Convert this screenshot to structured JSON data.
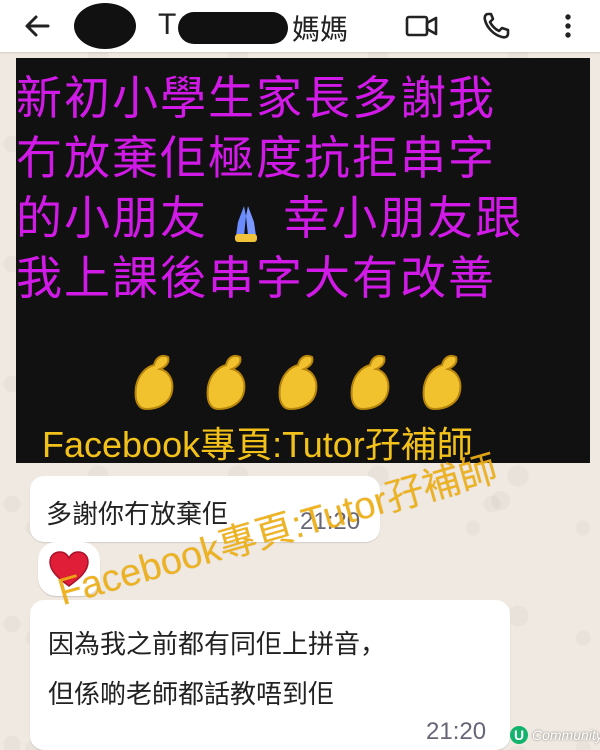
{
  "header": {
    "title_visible_start": "T",
    "title_visible_end": "媽媽",
    "back_icon": "back-arrow-icon",
    "video_icon": "video-camera-icon",
    "call_icon": "phone-icon",
    "menu_icon": "more-vertical-icon"
  },
  "poster": {
    "lines": [
      "新初小學生家長多謝我",
      "冇放棄佢極度抗拒串字",
      "的小朋友",
      "幸小朋友跟",
      "我上課後串字大有改善"
    ],
    "emoji_pray": "folded-hands-icon",
    "emoji_muscles": [
      "flexed-biceps-icon",
      "flexed-biceps-icon",
      "flexed-biceps-icon",
      "flexed-biceps-icon",
      "flexed-biceps-icon"
    ],
    "caption": "Facebook專頁:Tutor孖補師",
    "colors": {
      "background": "#111111",
      "headline": "#d21ae8",
      "caption": "#f3c21a"
    }
  },
  "messages": [
    {
      "text": "多謝你冇放棄佢",
      "time": "21:20",
      "reaction": "heart-icon"
    },
    {
      "lines": [
        "因為我之前都有同佢上拼音，",
        "但係啲老師都話教唔到佢"
      ],
      "time": "21:20"
    }
  ],
  "watermark": {
    "text": "Facebook專頁:Tutor孖補師"
  },
  "badge": {
    "mark": "U",
    "text": "Community"
  }
}
